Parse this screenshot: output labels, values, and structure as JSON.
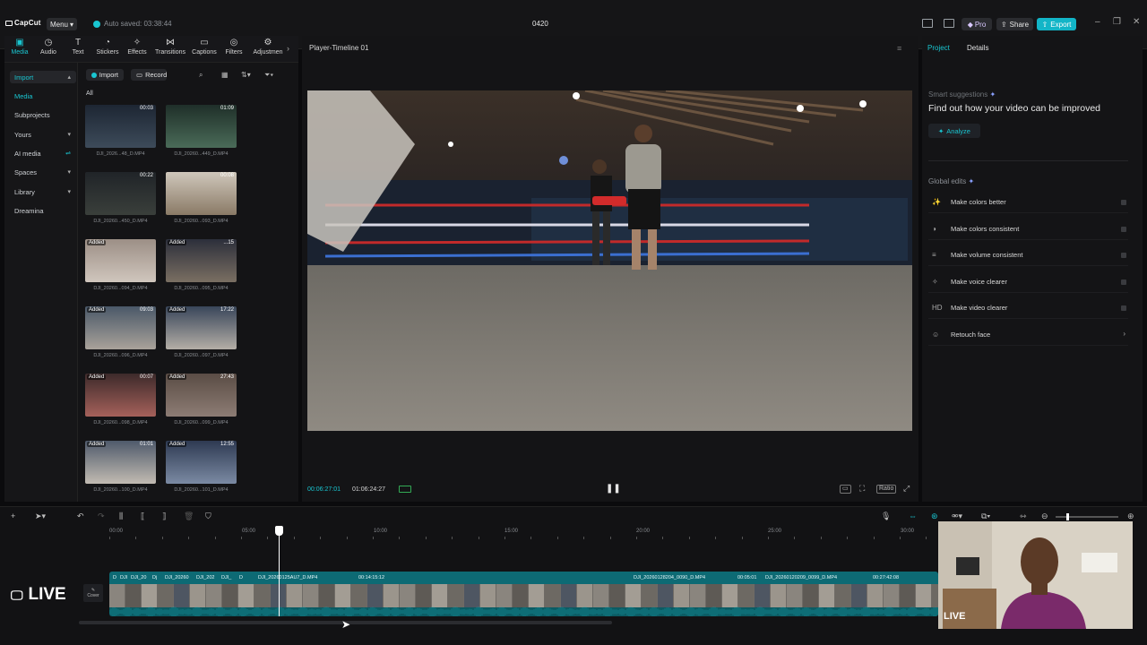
{
  "topbar": {
    "logo": "CapCut",
    "menu_label": "Menu",
    "autosave": "Auto saved: 03:38:44",
    "project_title": "0420",
    "pro_label": "Pro",
    "share_label": "Share",
    "export_label": "Export"
  },
  "toolbar": {
    "items": [
      "Media",
      "Audio",
      "Text",
      "Stickers",
      "Effects",
      "Transitions",
      "Captions",
      "Filters",
      "Adjustmen"
    ]
  },
  "sidenav": {
    "items": [
      "Import",
      "Media",
      "Subprojects",
      "Yours",
      "AI media",
      "Spaces",
      "Library",
      "Dreamina"
    ]
  },
  "media": {
    "import_label": "Import",
    "record_label": "Record",
    "filter_all": "All",
    "added_label": "Added",
    "clips": [
      {
        "name": "DJI_2026...48_D.MP4",
        "duration": "00:03"
      },
      {
        "name": "DJI_20260...449_D.MP4",
        "duration": "01:09"
      },
      {
        "name": "DJI_20260...450_D.MP4",
        "duration": "00:22"
      },
      {
        "name": "DJI_20260...093_D.MP4",
        "duration": "00:08"
      },
      {
        "name": "DJI_20260...094_D.MP4",
        "duration": ""
      },
      {
        "name": "DJI_20260...095_D.MP4",
        "duration": "...15"
      },
      {
        "name": "DJI_20260...096_D.MP4",
        "duration": "09:03"
      },
      {
        "name": "DJI_20260...097_D.MP4",
        "duration": "17:22"
      },
      {
        "name": "DJI_20260...098_D.MP4",
        "duration": "00:07"
      },
      {
        "name": "DJI_20260...099_D.MP4",
        "duration": "27:43"
      },
      {
        "name": "DJI_20260...100_D.MP4",
        "duration": "01:01"
      },
      {
        "name": "DJI_20260...101_D.MP4",
        "duration": "12:55"
      }
    ]
  },
  "player": {
    "title": "Player-Timeline 01",
    "current_time": "00:06:27:01",
    "total_time": "01:06:24:27",
    "ratio_label": "Ratio"
  },
  "rpanel": {
    "tab_project": "Project",
    "tab_details": "Details",
    "smart_suggestions": "Smart suggestions",
    "suggestion_title": "Find out how your video can be improved",
    "analyze_label": "Analyze",
    "global_edits": "Global edits",
    "edits": [
      {
        "icon": "✨",
        "label": "Make colors better"
      },
      {
        "icon": "◑",
        "label": "Make colors consistent"
      },
      {
        "icon": "≡",
        "label": "Make volume consistent"
      },
      {
        "icon": "✧",
        "label": "Make voice clearer"
      },
      {
        "icon": "HD",
        "label": "Make video clearer"
      },
      {
        "icon": "☺",
        "label": "Retouch face"
      }
    ]
  },
  "timeline": {
    "ruler": [
      "00:00",
      "05:00",
      "10:00",
      "15:00",
      "20:00",
      "25:00",
      "30:00"
    ],
    "clip_labels": [
      "D",
      "DJI",
      "DJI_20",
      "Dj",
      "DJI_20260",
      "DJI_202",
      "DJI_",
      "D",
      "DJI_20260125AU7_D.MP4",
      "00:14:15:12",
      "DJI_20260128204_0090_D.MP4",
      "00:05:01",
      "DJI_20260120209_0099_D.MP4",
      "00:27:42:08"
    ],
    "cover_label": "Cover",
    "live_label": "LIVE"
  },
  "webcam": {
    "live_label": "LIVE"
  },
  "colors": {
    "accent": "#19c6d1",
    "track": "#0d6a74",
    "background": "#0b0b0d"
  }
}
